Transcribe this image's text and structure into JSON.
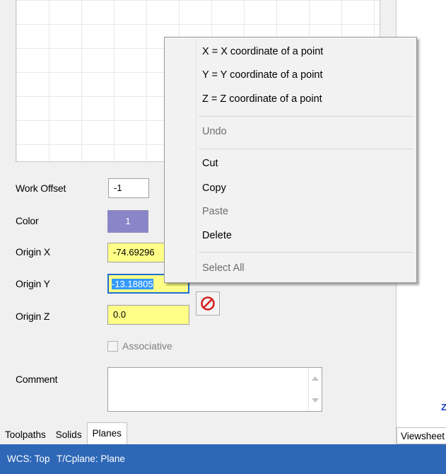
{
  "form": {
    "work_offset": {
      "label": "Work Offset",
      "value": "-1"
    },
    "color": {
      "label": "Color",
      "value": "1",
      "swatch": "#8a85c8"
    },
    "origin_x": {
      "label": "Origin X",
      "value": "-74.69296"
    },
    "origin_y": {
      "label": "Origin Y",
      "value": "-13.18805"
    },
    "origin_z": {
      "label": "Origin Z",
      "value": "0.0"
    },
    "associative": {
      "label": "Associative",
      "checked": false
    },
    "comment": {
      "label": "Comment",
      "value": ""
    }
  },
  "context_menu": {
    "items": [
      {
        "label": "X = X coordinate of a point",
        "enabled": true
      },
      {
        "label": "Y = Y coordinate of a point",
        "enabled": true
      },
      {
        "label": "Z = Z coordinate of a point",
        "enabled": true
      },
      {
        "label": "Undo",
        "enabled": false
      },
      {
        "label": "Cut",
        "enabled": true
      },
      {
        "label": "Copy",
        "enabled": true
      },
      {
        "label": "Paste",
        "enabled": false
      },
      {
        "label": "Delete",
        "enabled": true
      },
      {
        "label": "Select All",
        "enabled": false
      }
    ]
  },
  "tabs": [
    {
      "label": "Toolpaths",
      "active": false
    },
    {
      "label": "Solids",
      "active": false
    },
    {
      "label": "Planes",
      "active": true
    }
  ],
  "right_tab": {
    "label": "Viewsheet"
  },
  "right_marker": "Z",
  "status_bar": {
    "wcs": "WCS: Top",
    "tplane": "T/Cplane: Plane"
  },
  "icons": {
    "stop": "prohibited-icon"
  },
  "colors": {
    "status_bar": "#2e67b6",
    "highlight_field": "#ffff88",
    "selection": "#3399ff",
    "stop_icon": "#d42020"
  }
}
